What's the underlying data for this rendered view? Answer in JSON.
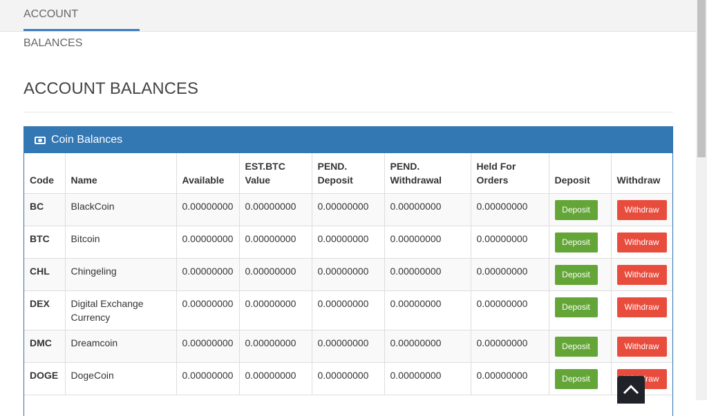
{
  "tab": {
    "label": "ACCOUNT BALANCES"
  },
  "page_title": "ACCOUNT BALANCES",
  "panel": {
    "title": "Coin Balances",
    "icon": "money-icon"
  },
  "table": {
    "headers": {
      "code": "Code",
      "name": "Name",
      "available": "Available",
      "est_btc_1": "EST.BTC",
      "est_btc_2": "Value",
      "pend_dep_1": "PEND.",
      "pend_dep_2": "Deposit",
      "pend_wd_1": "PEND.",
      "pend_wd_2": "Withdrawal",
      "held_1": "Held For",
      "held_2": "Orders",
      "deposit": "Deposit",
      "withdraw": "Withdraw"
    },
    "rows": [
      {
        "code": "BC",
        "name": "BlackCoin",
        "available": "0.00000000",
        "est_btc": "0.00000000",
        "pend_deposit": "0.00000000",
        "pend_withdrawal": "0.00000000",
        "held": "0.00000000",
        "deposit_label": "Deposit",
        "withdraw_label": "Withdraw"
      },
      {
        "code": "BTC",
        "name": "Bitcoin",
        "available": "0.00000000",
        "est_btc": "0.00000000",
        "pend_deposit": "0.00000000",
        "pend_withdrawal": "0.00000000",
        "held": "0.00000000",
        "deposit_label": "Deposit",
        "withdraw_label": "Withdraw"
      },
      {
        "code": "CHL",
        "name": "Chingeling",
        "available": "0.00000000",
        "est_btc": "0.00000000",
        "pend_deposit": "0.00000000",
        "pend_withdrawal": "0.00000000",
        "held": "0.00000000",
        "deposit_label": "Deposit",
        "withdraw_label": "Withdraw"
      },
      {
        "code": "DEX",
        "name": "Digital Exchange Currency",
        "available": "0.00000000",
        "est_btc": "0.00000000",
        "pend_deposit": "0.00000000",
        "pend_withdrawal": "0.00000000",
        "held": "0.00000000",
        "deposit_label": "Deposit",
        "withdraw_label": "Withdraw"
      },
      {
        "code": "DMC",
        "name": "Dreamcoin",
        "available": "0.00000000",
        "est_btc": "0.00000000",
        "pend_deposit": "0.00000000",
        "pend_withdrawal": "0.00000000",
        "held": "0.00000000",
        "deposit_label": "Deposit",
        "withdraw_label": "Withdraw"
      },
      {
        "code": "DOGE",
        "name": "DogeCoin",
        "available": "0.00000000",
        "est_btc": "0.00000000",
        "pend_deposit": "0.00000000",
        "pend_withdrawal": "0.00000000",
        "held": "0.00000000",
        "deposit_label": "Deposit",
        "withdraw_label": "Withdraw"
      }
    ]
  },
  "colors": {
    "panel_heading": "#3377b3",
    "deposit_button": "#63a536",
    "withdraw_button": "#e84c3d",
    "tab_underline": "#3a7bc1"
  },
  "back_to_top": {
    "icon": "chevron-up-icon"
  }
}
